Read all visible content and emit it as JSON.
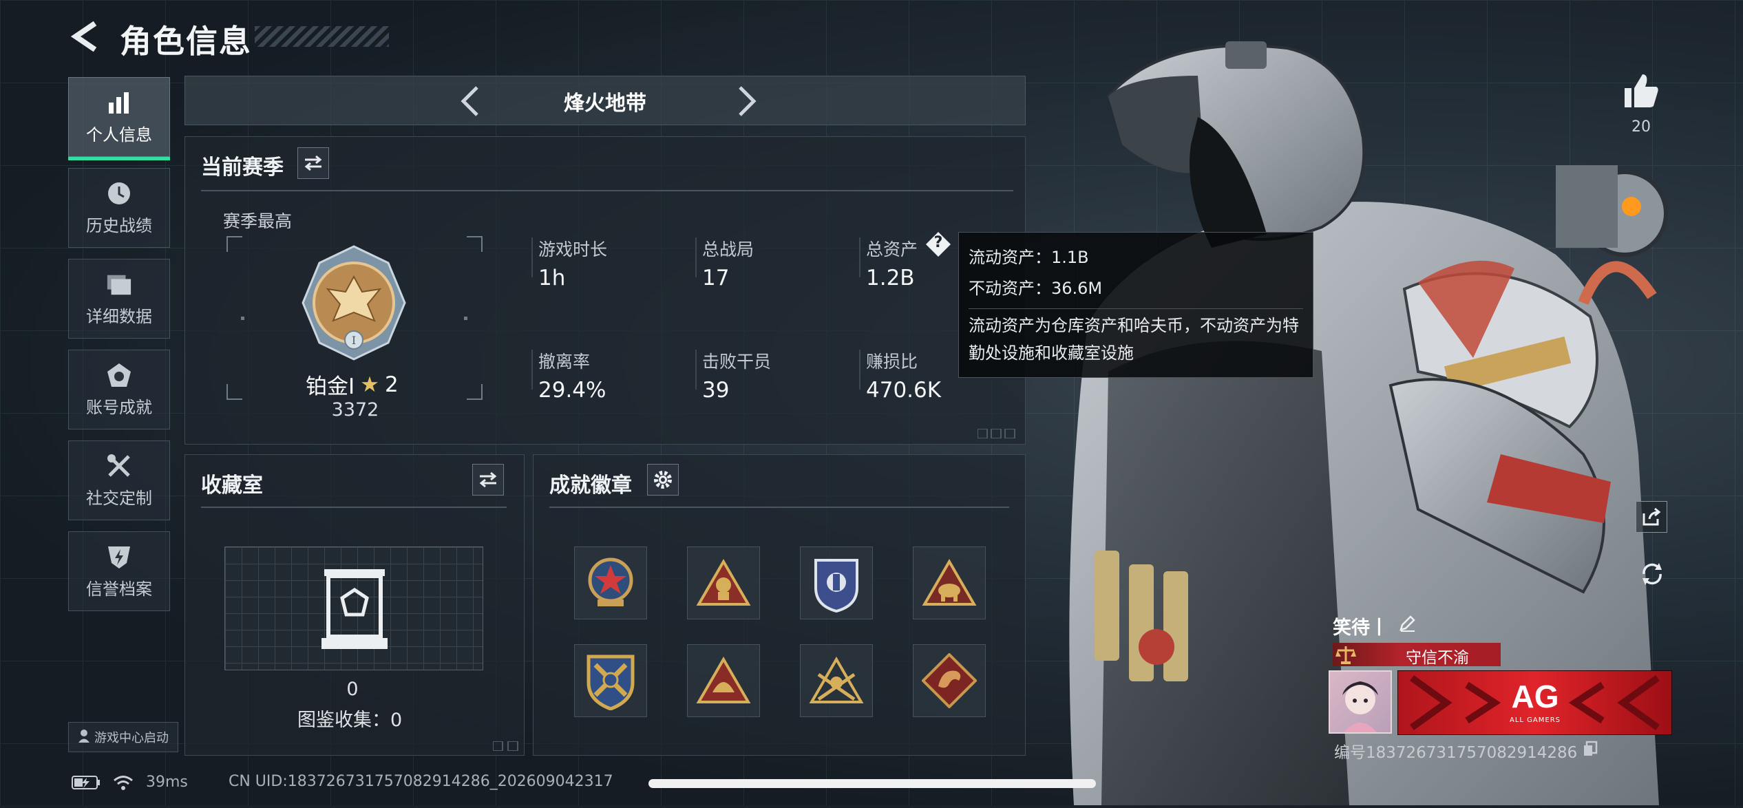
{
  "header": {
    "title": "角色信息"
  },
  "sidebar": {
    "items": [
      {
        "label": "个人信息",
        "icon": "bar-chart-icon",
        "active": true
      },
      {
        "label": "历史战绩",
        "icon": "clock-icon"
      },
      {
        "label": "详细数据",
        "icon": "folders-icon"
      },
      {
        "label": "账号成就",
        "icon": "achievement-icon"
      },
      {
        "label": "社交定制",
        "icon": "tools-icon"
      },
      {
        "label": "信誉档案",
        "icon": "shield-bolt-icon"
      }
    ],
    "launcher": "游戏中心启动"
  },
  "mode_tabs": {
    "current": "烽火地带"
  },
  "season": {
    "title": "当前赛季",
    "best_label": "赛季最高",
    "rank_name": "铂金Ⅰ",
    "rank_stars": "2",
    "rank_score": "3372",
    "stats": [
      {
        "label": "游戏时长",
        "value": "1h"
      },
      {
        "label": "总战局",
        "value": "17"
      },
      {
        "label": "总资产",
        "value": "1.2B"
      },
      {
        "label": "撤离率",
        "value": "29.4%"
      },
      {
        "label": "击败干员",
        "value": "39"
      },
      {
        "label": "赚损比",
        "value": "470.6K"
      }
    ],
    "help_glyph": "?"
  },
  "tooltip": {
    "liquid": "流动资产：1.1B",
    "fixed": "不动资产：36.6M",
    "desc": "流动资产为仓库资产和哈夫币，不动资产为特勤处设施和收藏室设施"
  },
  "collection": {
    "title": "收藏室",
    "count": "0",
    "catalog": "图鉴收集：0"
  },
  "badges": {
    "title": "成就徽章",
    "items": [
      "badge-star-shield",
      "badge-triangle-soldier",
      "badge-police-shield",
      "badge-triangle-elephant",
      "badge-crossed-guns",
      "badge-triangle-helmet",
      "badge-triangle-crossed-rifles",
      "badge-dragon-diamond"
    ]
  },
  "likes": {
    "count": "20"
  },
  "profile": {
    "name": "笑待丨",
    "title_tag": "守信不渝",
    "id_text": "编号1837267317570829142​86",
    "team_logo": "AG",
    "team_sub": "ALL GAMERS"
  },
  "status_bar": {
    "ping": "39ms",
    "uid": "CN UID:183726731757082914286_202609042317"
  },
  "colors": {
    "accent": "#2fe0a1",
    "tag_red": "#b3222a",
    "emblem_red": "#e0242a"
  }
}
